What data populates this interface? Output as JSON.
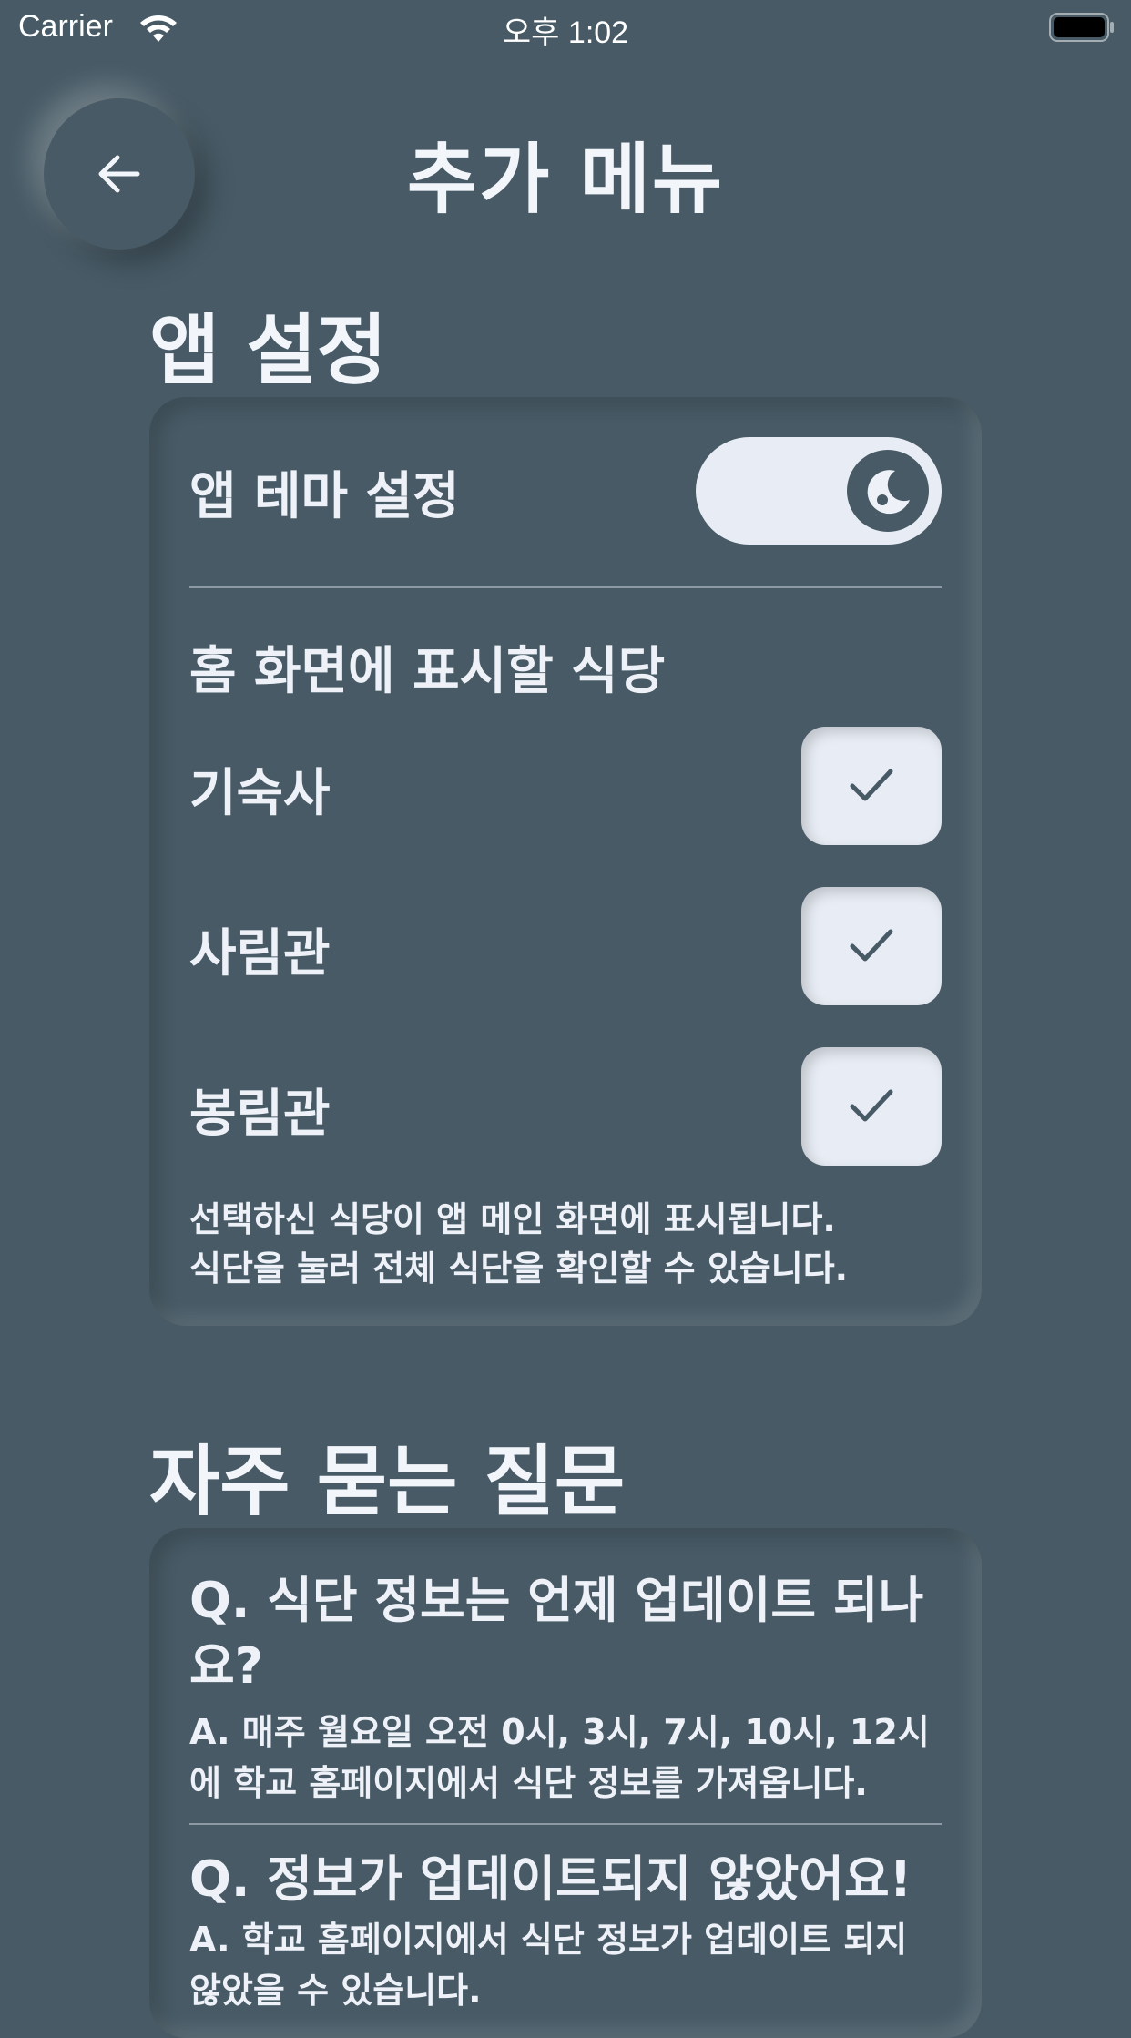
{
  "status_bar": {
    "carrier": "Carrier",
    "time": "오후 1:02"
  },
  "header": {
    "title": "추가 메뉴",
    "back_icon": "arrow-left-icon"
  },
  "app_settings": {
    "heading": "앱 설정",
    "theme": {
      "label": "앱 테마 설정",
      "toggle_icon": "moon-icon",
      "dark_mode": true
    },
    "home_cafeterias": {
      "label": "홈 화면에 표시할 식당",
      "items": [
        {
          "label": "기숙사",
          "checked": true
        },
        {
          "label": "사림관",
          "checked": true
        },
        {
          "label": "봉림관",
          "checked": true
        }
      ],
      "note_line1": "선택하신 식당이 앱 메인 화면에 표시됩니다.",
      "note_line2": "식단을 눌러 전체 식단을 확인할 수 있습니다."
    }
  },
  "faq": {
    "heading": "자주 묻는 질문",
    "items": [
      {
        "question": "Q. 식단 정보는 언제 업데이트 되나요?",
        "answer": "A. 매주 월요일 오전 0시, 3시, 7시, 10시, 12시에 학교 홈페이지에서 식단 정보를 가져옵니다."
      },
      {
        "question": "Q. 정보가 업데이트되지 않았어요!",
        "answer": "A. 학교 홈페이지에서 식단 정보가 업데이트 되지 않았을 수 있습니다."
      }
    ]
  },
  "colors": {
    "background": "#475a65",
    "surface_light": "#e8edf5",
    "text": "#eef2f8"
  }
}
